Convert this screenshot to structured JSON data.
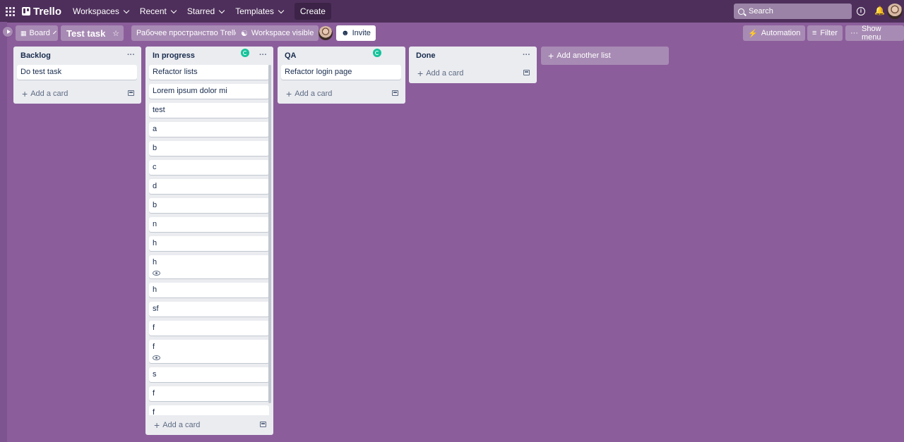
{
  "topnav": {
    "logo": "Trello",
    "items": [
      "Workspaces",
      "Recent",
      "Starred",
      "Templates"
    ],
    "create": "Create",
    "search_placeholder": "Search"
  },
  "board_header": {
    "view": "Board",
    "title": "Test task",
    "workspace": "Рабочее пространство Trello",
    "visibility": "Workspace visible",
    "invite": "Invite",
    "automation": "Automation",
    "filter": "Filter",
    "show_menu": "Show menu"
  },
  "lists": [
    {
      "title": "Backlog",
      "cards": [
        "Do test task"
      ],
      "add_card": "Add a card"
    },
    {
      "title": "In progress",
      "cards": [
        "Refactor lists",
        "Lorem ipsum dolor mi",
        "test",
        "a",
        "b",
        "c",
        "d",
        "b",
        "n",
        "h",
        "h",
        "h",
        "sf",
        "f",
        "f",
        "s",
        "f",
        "f"
      ],
      "add_card": "Add a card"
    },
    {
      "title": "QA",
      "cards": [
        "Refactor login page"
      ],
      "add_card": "Add a card"
    },
    {
      "title": "Done",
      "cards": [],
      "add_card": "Add a card"
    }
  ],
  "add_list": "Add another list",
  "colors": {
    "board_bg": "#8b5e9b",
    "nav_bg": "#4e2f5b",
    "list_bg": "#ebecf0"
  },
  "icons": {
    "watch": "eye-icon",
    "template": "card-template-icon",
    "grammarly": "grammarly-icon"
  }
}
